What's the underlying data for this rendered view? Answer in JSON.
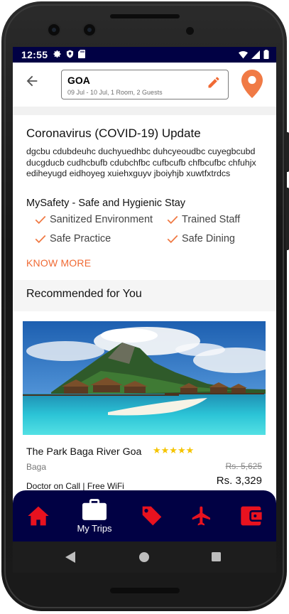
{
  "status_bar": {
    "time": "12:55"
  },
  "search": {
    "destination": "GOA",
    "details": "09 Jul - 10 Jul, 1 Room, 2 Guests"
  },
  "covid": {
    "title": "Coronavirus (COVID-19) Update",
    "text": "dgcbu cdubdeuhc duchyuedhbc duhcyeoudbc cuyegbcubd ducgducb cudhcbufb cdubchfbc cufbcufb chfbcufbc chfuhjx ediheyugd eidhoyeg xuiehxguyv jboiyhjb xuwtfxtrdcs",
    "safety_title": "MySafety - Safe and Hygienic Stay",
    "safety_items": [
      "Sanitized Environment",
      "Trained Staff",
      "Safe Practice",
      "Safe Dining"
    ],
    "know_more": "KNOW MORE"
  },
  "recommended": {
    "title": "Recommended for You",
    "hotel": {
      "name": "The Park Baga River Goa",
      "stars": "★★★★★",
      "location": "Baga",
      "old_price": "Rs. 5,625",
      "price": "Rs. 3,329",
      "amenities": "Doctor on Call | Free WiFi"
    }
  },
  "bottom_nav": {
    "items": [
      {
        "icon": "home-icon",
        "label": ""
      },
      {
        "icon": "briefcase-icon",
        "label": "My Trips"
      },
      {
        "icon": "tag-icon",
        "label": ""
      },
      {
        "icon": "airplane-icon",
        "label": ""
      },
      {
        "icon": "wallet-icon",
        "label": ""
      }
    ]
  },
  "colors": {
    "nav_bg": "#010144",
    "accent_orange": "#f06a34",
    "nav_icon_red": "#e8121f",
    "check_orange": "#f07a45",
    "star_yellow": "#f5c400"
  }
}
